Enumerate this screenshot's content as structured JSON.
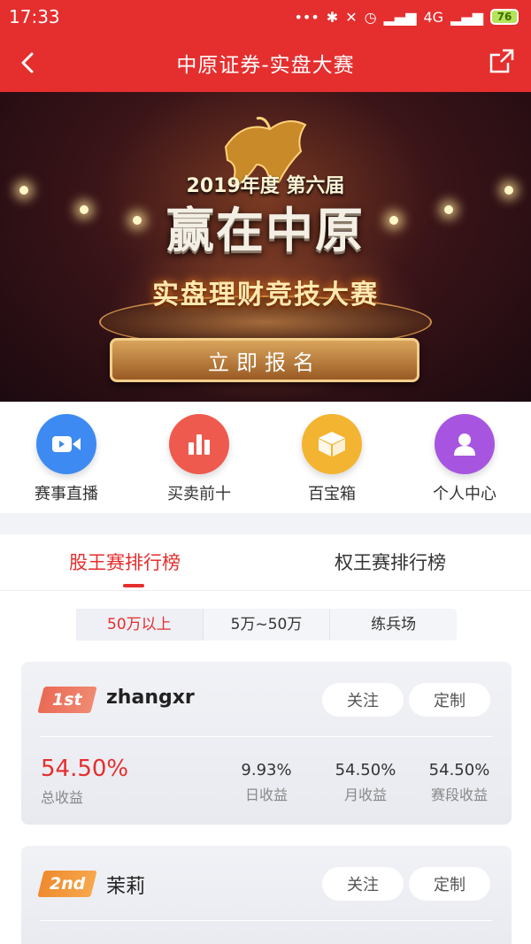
{
  "status_bar": {
    "time": "17:33",
    "network": "4G",
    "battery": "76"
  },
  "nav": {
    "title": "中原证券-实盘大赛",
    "back_icon": "chevron-left-icon",
    "share_icon": "share-icon"
  },
  "banner": {
    "year_text": "2019年度 第六届",
    "main_text": "赢在中原",
    "sub_text": "实盘理财竞技大赛",
    "register_label": "立即报名"
  },
  "quick_links": [
    {
      "label": "赛事直播",
      "icon": "video-camera-icon",
      "color": "#3d8af2"
    },
    {
      "label": "买卖前十",
      "icon": "bar-chart-icon",
      "color": "#ef5a4e"
    },
    {
      "label": "百宝箱",
      "icon": "box-icon",
      "color": "#f3b431"
    },
    {
      "label": "个人中心",
      "icon": "user-icon",
      "color": "#a755e0"
    }
  ],
  "tabs": [
    {
      "label": "股王赛排行榜"
    },
    {
      "label": "权王赛排行榜"
    }
  ],
  "filters": [
    {
      "label": "50万以上"
    },
    {
      "label": "5万~50万"
    },
    {
      "label": "练兵场"
    }
  ],
  "leaderboard": [
    {
      "rank": "1st",
      "name": "zhangxr",
      "follow_label": "关注",
      "custom_label": "定制",
      "total_return": "54.50%",
      "total_label": "总收益",
      "stats": [
        {
          "value": "9.93%",
          "label": "日收益"
        },
        {
          "value": "54.50%",
          "label": "月收益"
        },
        {
          "value": "54.50%",
          "label": "赛段收益"
        }
      ]
    },
    {
      "rank": "2nd",
      "name": "茉莉",
      "follow_label": "关注",
      "custom_label": "定制"
    }
  ]
}
